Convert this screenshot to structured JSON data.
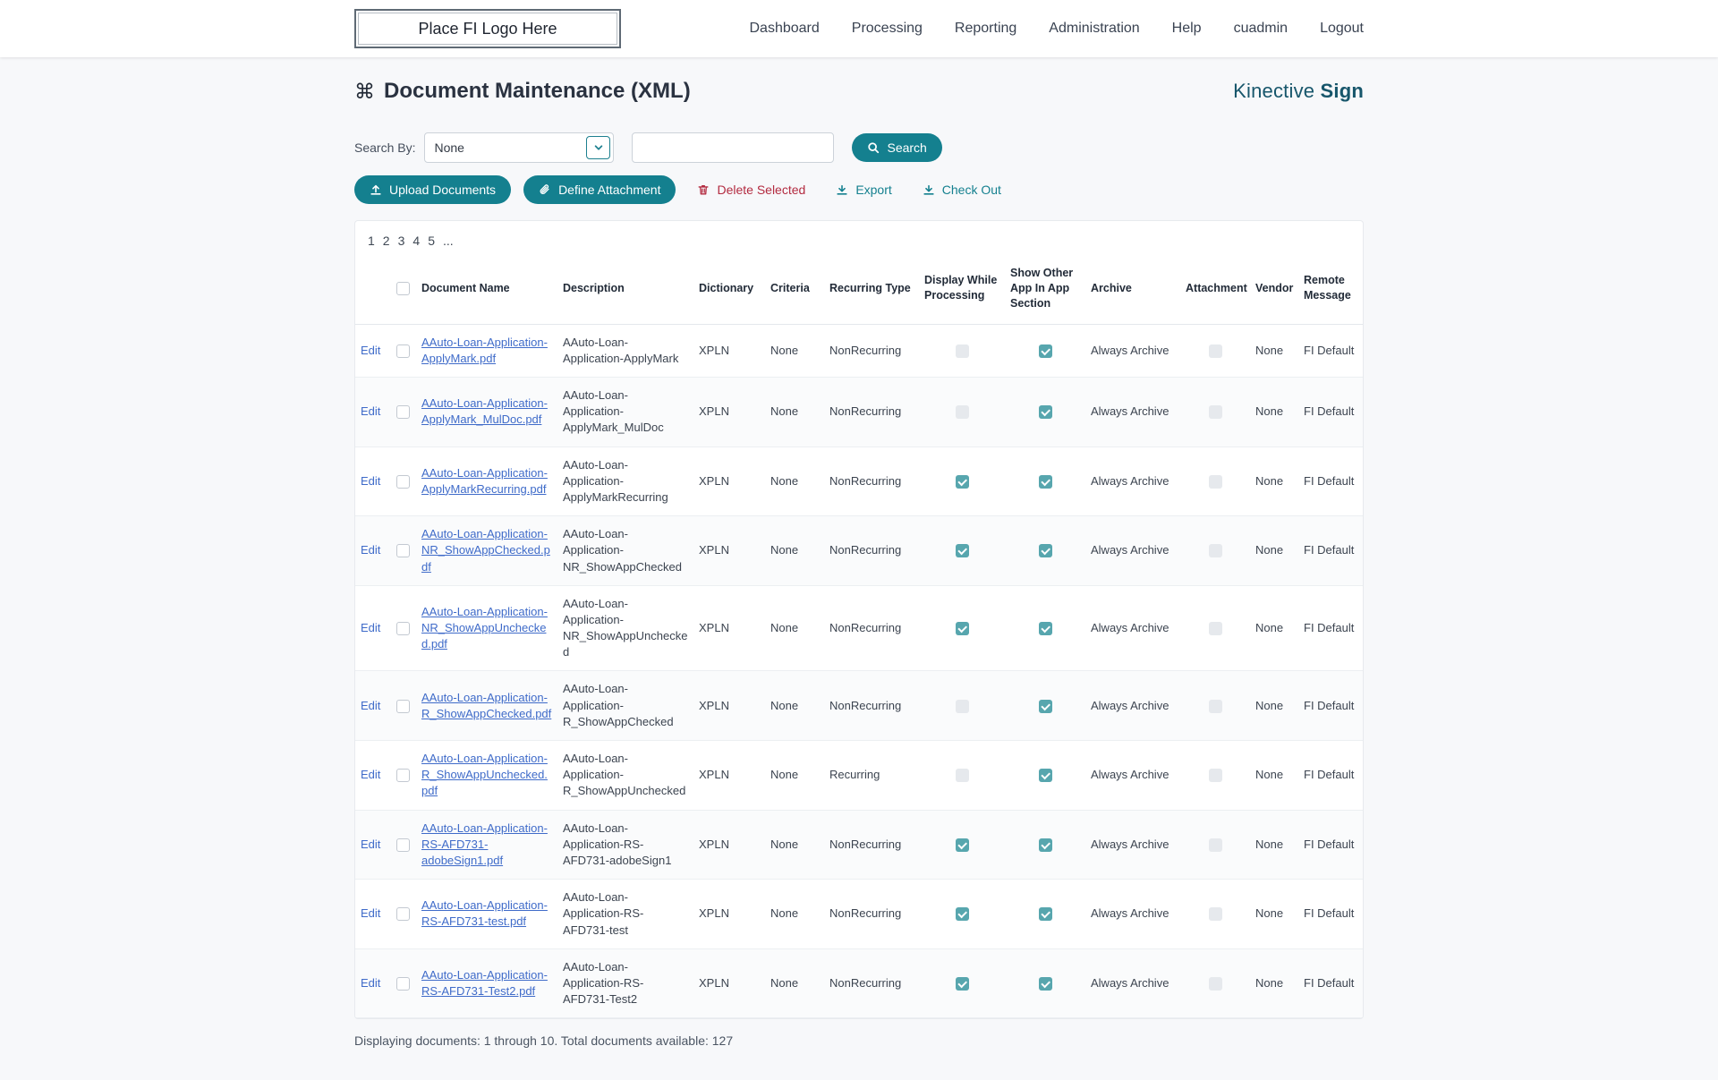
{
  "header": {
    "logo_text": "Place FI Logo Here",
    "nav": [
      "Dashboard",
      "Processing",
      "Reporting",
      "Administration",
      "Help",
      "cuadmin",
      "Logout"
    ]
  },
  "page": {
    "title": "Document Maintenance (XML)",
    "title_icon": "⌘",
    "brand": {
      "name": "Kinective",
      "product": "Sign"
    }
  },
  "search": {
    "label": "Search By:",
    "selected_option": "None",
    "query_value": "",
    "button_label": "Search"
  },
  "actions": {
    "upload": "Upload Documents",
    "define_attachment": "Define Attachment",
    "delete_selected": "Delete Selected",
    "export": "Export",
    "check_out": "Check Out"
  },
  "pagination": {
    "pages": [
      "1",
      "2",
      "3",
      "4",
      "5",
      "..."
    ]
  },
  "table": {
    "edit_label": "Edit",
    "columns": [
      "Document Name",
      "Description",
      "Dictionary",
      "Criteria",
      "Recurring Type",
      "Display While Processing",
      "Show Other App In App Section",
      "Archive",
      "Attachment",
      "Vendor",
      "Remote Message"
    ],
    "rows": [
      {
        "document_name": "AAuto-Loan-Application-ApplyMark.pdf",
        "description": "AAuto-Loan-Application-ApplyMark",
        "dictionary": "XPLN",
        "criteria": "None",
        "recurring_type": "NonRecurring",
        "display_while_processing": false,
        "show_other_app": true,
        "archive": "Always Archive",
        "attachment": false,
        "vendor": "None",
        "remote_message": "FI Default"
      },
      {
        "document_name": "AAuto-Loan-Application-ApplyMark_MulDoc.pdf",
        "description": "AAuto-Loan-Application-ApplyMark_MulDoc",
        "dictionary": "XPLN",
        "criteria": "None",
        "recurring_type": "NonRecurring",
        "display_while_processing": false,
        "show_other_app": true,
        "archive": "Always Archive",
        "attachment": false,
        "vendor": "None",
        "remote_message": "FI Default"
      },
      {
        "document_name": "AAuto-Loan-Application-ApplyMarkRecurring.pdf",
        "description": "AAuto-Loan-Application-ApplyMarkRecurring",
        "dictionary": "XPLN",
        "criteria": "None",
        "recurring_type": "NonRecurring",
        "display_while_processing": true,
        "show_other_app": true,
        "archive": "Always Archive",
        "attachment": false,
        "vendor": "None",
        "remote_message": "FI Default"
      },
      {
        "document_name": "AAuto-Loan-Application-NR_ShowAppChecked.pdf",
        "description": "AAuto-Loan-Application-NR_ShowAppChecked",
        "dictionary": "XPLN",
        "criteria": "None",
        "recurring_type": "NonRecurring",
        "display_while_processing": true,
        "show_other_app": true,
        "archive": "Always Archive",
        "attachment": false,
        "vendor": "None",
        "remote_message": "FI Default"
      },
      {
        "document_name": "AAuto-Loan-Application-NR_ShowAppUnchecked.pdf",
        "description": "AAuto-Loan-Application-NR_ShowAppUnchecked",
        "dictionary": "XPLN",
        "criteria": "None",
        "recurring_type": "NonRecurring",
        "display_while_processing": true,
        "show_other_app": true,
        "archive": "Always Archive",
        "attachment": false,
        "vendor": "None",
        "remote_message": "FI Default"
      },
      {
        "document_name": "AAuto-Loan-Application-R_ShowAppChecked.pdf",
        "description": "AAuto-Loan-Application-R_ShowAppChecked",
        "dictionary": "XPLN",
        "criteria": "None",
        "recurring_type": "NonRecurring",
        "display_while_processing": false,
        "show_other_app": true,
        "archive": "Always Archive",
        "attachment": false,
        "vendor": "None",
        "remote_message": "FI Default"
      },
      {
        "document_name": "AAuto-Loan-Application-R_ShowAppUnchecked.pdf",
        "description": "AAuto-Loan-Application-R_ShowAppUnchecked",
        "dictionary": "XPLN",
        "criteria": "None",
        "recurring_type": "Recurring",
        "display_while_processing": false,
        "show_other_app": true,
        "archive": "Always Archive",
        "attachment": false,
        "vendor": "None",
        "remote_message": "FI Default"
      },
      {
        "document_name": "AAuto-Loan-Application-RS-AFD731-adobeSign1.pdf",
        "description": "AAuto-Loan-Application-RS-AFD731-adobeSign1",
        "dictionary": "XPLN",
        "criteria": "None",
        "recurring_type": "NonRecurring",
        "display_while_processing": true,
        "show_other_app": true,
        "archive": "Always Archive",
        "attachment": false,
        "vendor": "None",
        "remote_message": "FI Default"
      },
      {
        "document_name": "AAuto-Loan-Application-RS-AFD731-test.pdf",
        "description": "AAuto-Loan-Application-RS-AFD731-test",
        "dictionary": "XPLN",
        "criteria": "None",
        "recurring_type": "NonRecurring",
        "display_while_processing": true,
        "show_other_app": true,
        "archive": "Always Archive",
        "attachment": false,
        "vendor": "None",
        "remote_message": "FI Default"
      },
      {
        "document_name": "AAuto-Loan-Application-RS-AFD731-Test2.pdf",
        "description": "AAuto-Loan-Application-RS-AFD731-Test2",
        "dictionary": "XPLN",
        "criteria": "None",
        "recurring_type": "NonRecurring",
        "display_while_processing": true,
        "show_other_app": true,
        "archive": "Always Archive",
        "attachment": false,
        "vendor": "None",
        "remote_message": "FI Default"
      }
    ]
  },
  "footer": {
    "summary": "Displaying documents: 1 through 10. Total documents available: 127"
  },
  "colors": {
    "accent_teal": "#14808f",
    "brand_teal": "#17566b",
    "link_blue": "#3f6bc9",
    "danger_red": "#b32b40",
    "checkbox_checked": "#57a6ae",
    "page_background": "#f7f8fa"
  }
}
